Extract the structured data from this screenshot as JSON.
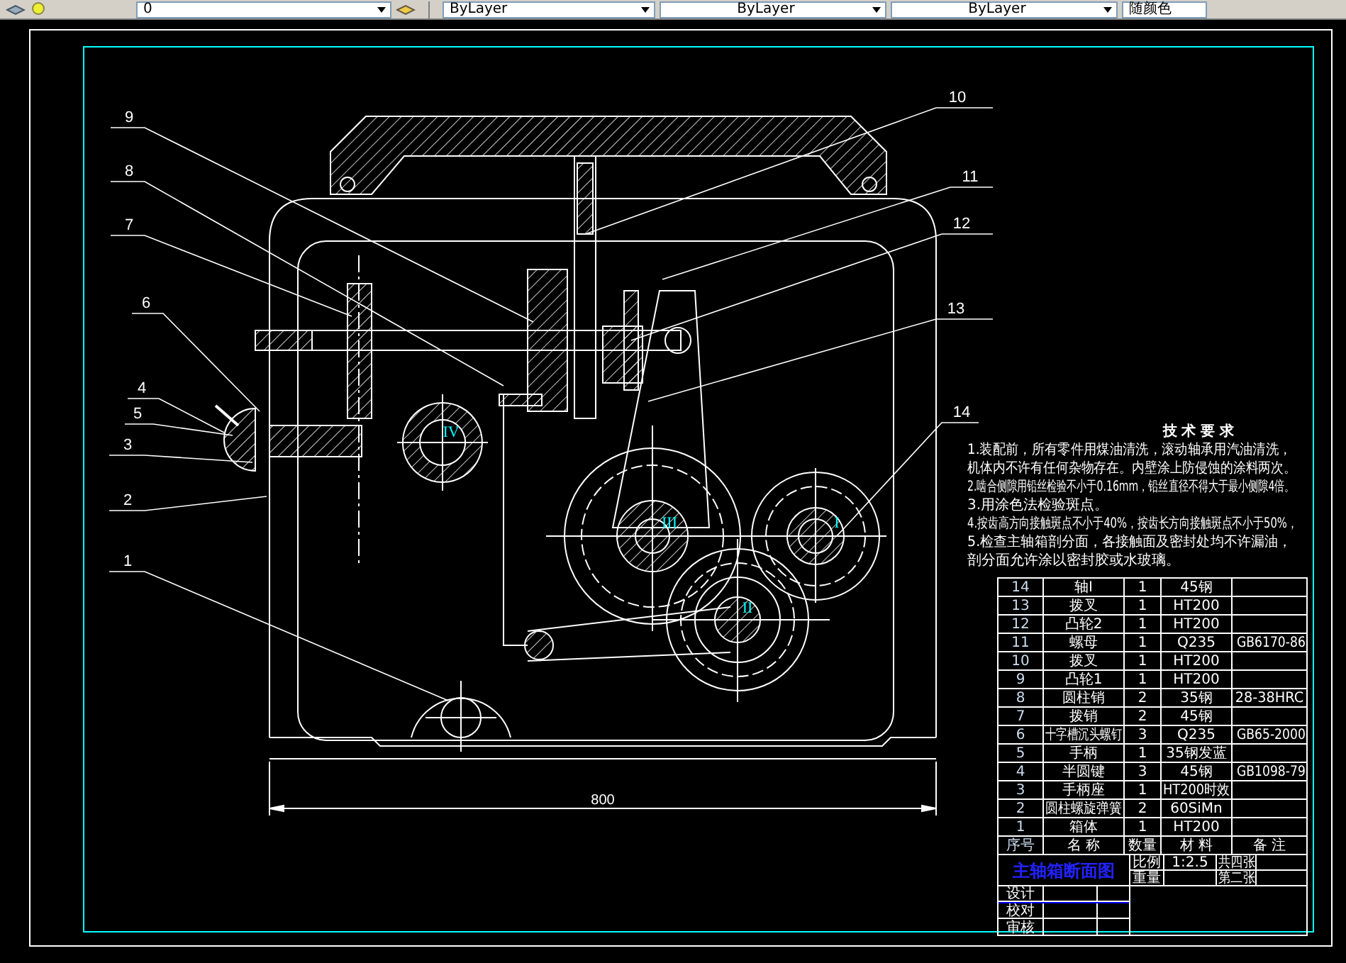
{
  "toolbar": {
    "layer": "0",
    "property_combos": [
      "ByLayer",
      "ByLayer",
      "ByLayer"
    ],
    "plot_style": "随颜色"
  },
  "drawing": {
    "callouts": [
      "9",
      "8",
      "7",
      "6",
      "4",
      "5",
      "3",
      "2",
      "1",
      "10",
      "11",
      "12",
      "13",
      "14"
    ],
    "shaft_labels": [
      "IV",
      "III",
      "II",
      "I"
    ],
    "dimension": "800"
  },
  "technical_requirements": {
    "title": "技 术 要 求",
    "lines": [
      "1.装配前，所有零件用煤油清洗，滚动轴承用汽油清洗，",
      "机体内不许有任何杂物存在。内壁涂上防侵蚀的涂料两次。",
      "2.啮合侧隙用铅丝检验不小于0.16mm，铅丝直径不得大于最小侧隙4倍。",
      "3.用涂色法检验斑点。",
      "4.按齿高方向接触斑点不小于40%，按齿长方向接触斑点不小于50%，",
      "5.检查主轴箱剖分面，各接触面及密封处均不许漏油，",
      "剖分面允许涂以密封胶或水玻璃。"
    ]
  },
  "parts_list": {
    "rows": [
      {
        "no": "14",
        "name": "轴Ⅰ",
        "qty": "1",
        "material": "45钢",
        "note": ""
      },
      {
        "no": "13",
        "name": "拨叉",
        "qty": "1",
        "material": "HT200",
        "note": ""
      },
      {
        "no": "12",
        "name": "凸轮2",
        "qty": "1",
        "material": "HT200",
        "note": ""
      },
      {
        "no": "11",
        "name": "螺母",
        "qty": "1",
        "material": "Q235",
        "note": "GB6170-86"
      },
      {
        "no": "10",
        "name": "拨叉",
        "qty": "1",
        "material": "HT200",
        "note": ""
      },
      {
        "no": "9",
        "name": "凸轮1",
        "qty": "1",
        "material": "HT200",
        "note": ""
      },
      {
        "no": "8",
        "name": "圆柱销",
        "qty": "2",
        "material": "35钢",
        "note": "28-38HRC"
      },
      {
        "no": "7",
        "name": "拨销",
        "qty": "2",
        "material": "45钢",
        "note": ""
      },
      {
        "no": "6",
        "name": "十字槽沉头螺钉",
        "qty": "3",
        "material": "Q235",
        "note": "GB65-2000"
      },
      {
        "no": "5",
        "name": "手柄",
        "qty": "1",
        "material": "35钢发蓝",
        "note": ""
      },
      {
        "no": "4",
        "name": "半圆键",
        "qty": "3",
        "material": "45钢",
        "note": "GB1098-79"
      },
      {
        "no": "3",
        "name": "手柄座",
        "qty": "1",
        "material": "HT200时效",
        "note": ""
      },
      {
        "no": "2",
        "name": "圆柱螺旋弹簧",
        "qty": "2",
        "material": "60SiMn",
        "note": ""
      },
      {
        "no": "1",
        "name": "箱体",
        "qty": "1",
        "material": "HT200",
        "note": ""
      }
    ],
    "header": {
      "no": "序号",
      "name": "名 称",
      "qty": "数量",
      "material": "材 料",
      "note": "备 注"
    }
  },
  "title_block": {
    "title": "主轴箱断面图",
    "scale_label": "比例",
    "scale": "1:2.5",
    "sheets": "共四张",
    "weight_label": "重量",
    "sheet": "第二张",
    "designed": "设计",
    "checked": "校对",
    "approved": "审核"
  }
}
